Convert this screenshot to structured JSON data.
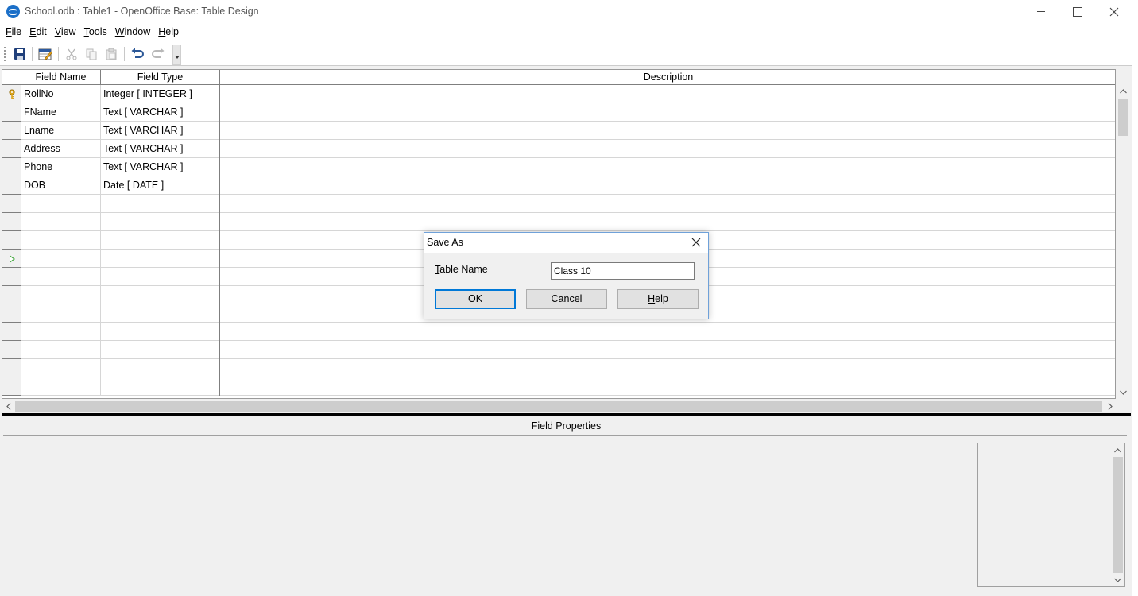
{
  "window": {
    "title": "School.odb : Table1 - OpenOffice Base: Table Design"
  },
  "menu": [
    {
      "label": "File",
      "mnemonic": "F",
      "rest": "ile"
    },
    {
      "label": "Edit",
      "mnemonic": "E",
      "rest": "dit"
    },
    {
      "label": "View",
      "mnemonic": "V",
      "rest": "iew"
    },
    {
      "label": "Tools",
      "mnemonic": "T",
      "rest": "ools"
    },
    {
      "label": "Window",
      "mnemonic": "W",
      "rest": "indow"
    },
    {
      "label": "Help",
      "mnemonic": "H",
      "rest": "elp"
    }
  ],
  "toolbar": {
    "icons": [
      "save-icon",
      "edit-table-icon",
      "cut-icon",
      "copy-icon",
      "paste-icon",
      "undo-icon",
      "redo-icon",
      "more-options-icon"
    ]
  },
  "grid": {
    "headers": {
      "field_name": "Field Name",
      "field_type": "Field Type",
      "description": "Description"
    },
    "rows": [
      {
        "name": "RollNo",
        "type": "Integer [ INTEGER ]",
        "description": "",
        "primary_key": true
      },
      {
        "name": "FName",
        "type": "Text [ VARCHAR ]",
        "description": ""
      },
      {
        "name": "Lname",
        "type": "Text [ VARCHAR ]",
        "description": ""
      },
      {
        "name": "Address",
        "type": "Text [ VARCHAR ]",
        "description": ""
      },
      {
        "name": "Phone",
        "type": "Text [ VARCHAR ]",
        "description": ""
      },
      {
        "name": "DOB",
        "type": "Date [ DATE ]",
        "description": ""
      }
    ],
    "empty_row_count": 11,
    "current_row_index": 9
  },
  "field_properties": {
    "title": "Field Properties"
  },
  "dialog": {
    "title": "Save As",
    "label": "Table Name",
    "label_mnemonic": "T",
    "label_rest": "able Name",
    "input_value": "Class 10",
    "ok_label": "OK",
    "cancel_label": "Cancel",
    "help_label": "Help",
    "help_mnemonic": "H",
    "help_rest": "elp"
  },
  "colors": {
    "accent": "#0078d7",
    "current_row_marker": "#3aa334",
    "key_icon": "#d9a21b"
  }
}
